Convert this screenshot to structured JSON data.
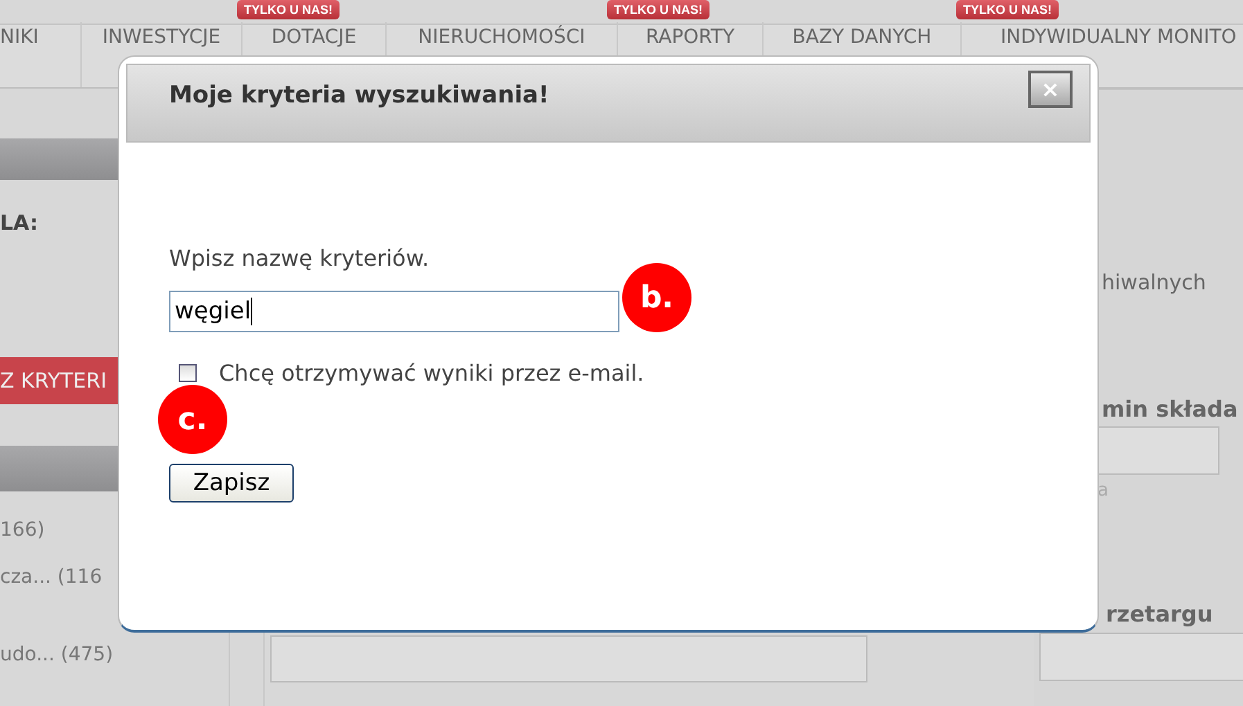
{
  "nav": [
    {
      "label": "NIKI"
    },
    {
      "label": "INWESTYCJE"
    },
    {
      "label": "DOTACJE",
      "badge": "TYLKO U NAS!"
    },
    {
      "label": "NIERUCHOMOŚCI"
    },
    {
      "label": "RAPORTY",
      "badge": "TYLKO U NAS!"
    },
    {
      "label": "BAZY DANYCH"
    },
    {
      "label": "INDYWIDUALNY MONITO",
      "badge": "TYLKO U NAS!"
    }
  ],
  "left": {
    "heading": "LA:",
    "button": "Z KRYTERI",
    "items": [
      "166)",
      "cza... (116",
      "udo... (475)"
    ]
  },
  "right": {
    "archive_text": "hiwalnych",
    "deadline_label": "min składa",
    "hint": "a",
    "tender_label": "rzetargu"
  },
  "dialog": {
    "title": "Moje kryteria wyszukiwania!",
    "close": "×",
    "prompt": "Wpisz nazwę kryteriów.",
    "name_value": "węgiel",
    "email_checkbox": {
      "label": "Chcę otrzymywać wyniki przez e-mail.",
      "checked": false
    },
    "save_button": "Zapisz"
  },
  "annotations": [
    "b.",
    "c."
  ]
}
